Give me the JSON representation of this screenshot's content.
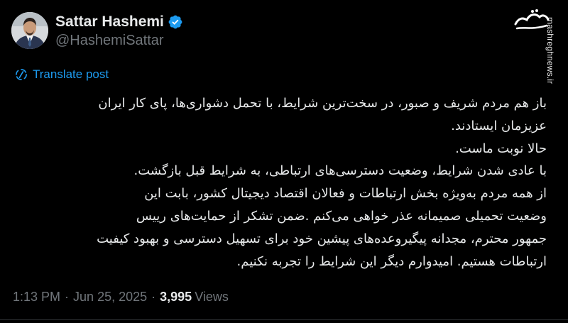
{
  "author": {
    "display_name": "Sattar Hashemi",
    "handle": "@HashemiSattar",
    "verified": true
  },
  "watermark": {
    "logo_text": "مشرق",
    "site": "mashreghnews.ir"
  },
  "translate_label": "Translate post",
  "tweet_lines": [
    "باز هم مردم شریف و صبور، در سخت‌ترین شرایط، با تحمل دشواری‌ها، پای کار ایران",
    "عزیزمان ایستادند.",
    "حالا نوبت ماست.",
    "با عادی شدن شرایط، وضعیت دسترسی‌های ارتباطی، به شرایط قبل بازگشت.",
    "از همه مردم به‌ویژه بخش ارتباطات و فعالان اقتصاد دیجیتال کشور، بابت این",
    "وضعیت تحمیلی صمیمانه عذر خواهی می‌کنم .ضمن تشکر از حمایت‌های رییس",
    "جمهور محترم، مجدانه پیگیروعده‌های پیشین خود برای تسهیل دسترسی و بهبود کیفیت",
    "ارتباطات هستیم. امیدوارم دیگر این شرایط را تجربه نکنیم."
  ],
  "meta": {
    "time": "1:13 PM",
    "separator": "·",
    "date": "Jun 25, 2025",
    "views_count": "3,995",
    "views_label": "Views"
  },
  "colors": {
    "background": "#000000",
    "text": "#e7e9ea",
    "secondary": "#71767b",
    "accent": "#1d9bf0",
    "verified_badge": "#1d9bf0"
  },
  "icons": {
    "verified": "verified-badge-icon",
    "translate": "translate-icon"
  }
}
